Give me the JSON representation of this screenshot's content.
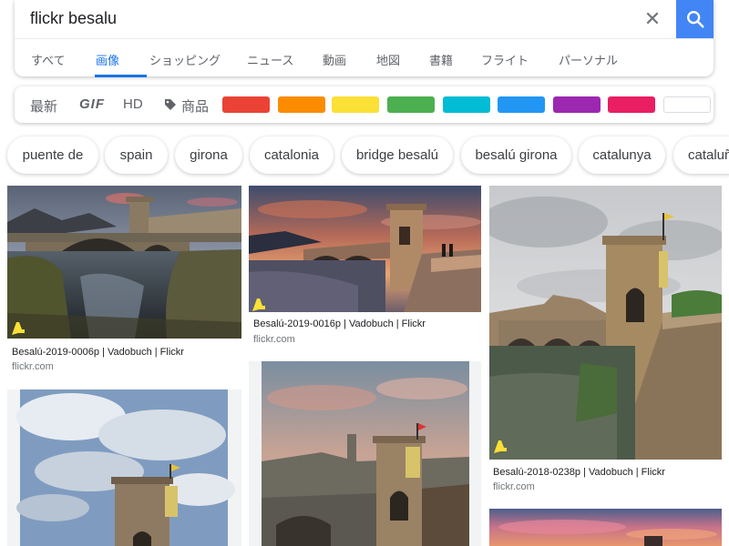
{
  "search": {
    "query": "flickr besalu",
    "clear_icon": "close-icon",
    "submit_icon": "search-icon",
    "accent": "#4285f4"
  },
  "tabs": [
    {
      "label": "すべて",
      "active": false
    },
    {
      "label": "画像",
      "active": true
    },
    {
      "label": "ショッピング",
      "active": false
    },
    {
      "label": "ニュース",
      "active": false
    },
    {
      "label": "動画",
      "active": false
    },
    {
      "label": "地図",
      "active": false
    },
    {
      "label": "書籍",
      "active": false
    },
    {
      "label": "フライト",
      "active": false
    },
    {
      "label": "パーソナル",
      "active": false
    }
  ],
  "filters": {
    "latest": "最新",
    "gif": "GIF",
    "hd": "HD",
    "products": "商品",
    "products_icon": "tag-icon",
    "colors": [
      "#ea4335",
      "#fb8c00",
      "#fbe035",
      "#4caf50",
      "#00bcd4",
      "#2196f3",
      "#9c27b0",
      "#e91e63",
      "#ffffff"
    ]
  },
  "chips": [
    "puente de",
    "spain",
    "girona",
    "catalonia",
    "bridge besalú",
    "besalú girona",
    "catalunya",
    "cataluñ"
  ],
  "results": [
    {
      "title": "Besalú-2019-0006p | Vadobuch | Flickr",
      "source": "flickr.com"
    },
    {
      "title": "Besalú-2019-0016p | Vadobuch | Flickr",
      "source": "flickr.com"
    },
    {
      "title": "Besalú-2018-0238p | Vadobuch | Flickr",
      "source": "flickr.com"
    }
  ]
}
